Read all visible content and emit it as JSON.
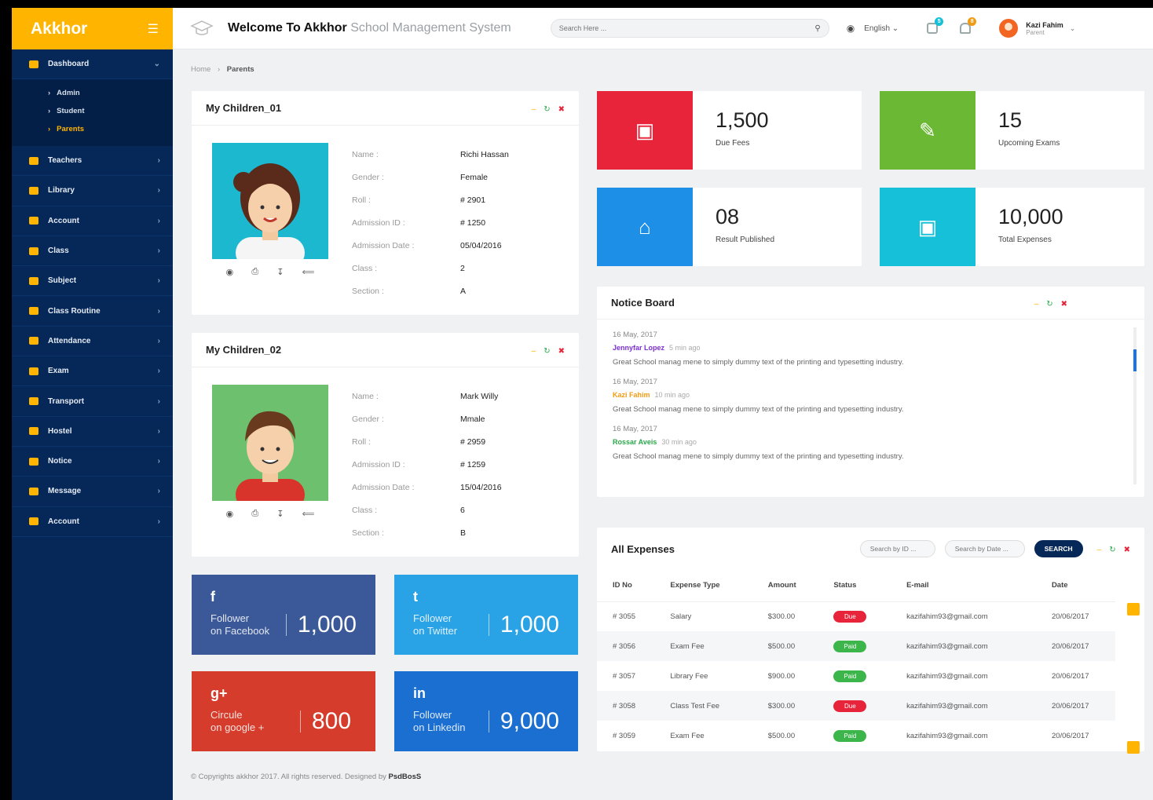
{
  "brand": {
    "name": "Akkhor"
  },
  "sidebar": {
    "dashboard": "Dashboard",
    "submenu": [
      "Admin",
      "Student",
      "Parents"
    ],
    "items": [
      "Teachers",
      "Library",
      "Account",
      "Class",
      "Subject",
      "Class Routine",
      "Attendance",
      "Exam",
      "Transport",
      "Hostel",
      "Notice",
      "Message",
      "Account"
    ]
  },
  "header": {
    "welcome_bold": "Welcome To Akkhor",
    "welcome_light": "School Management System",
    "search_placeholder": "Search Here ...",
    "language": "English",
    "badge_messages": "5",
    "badge_notifications": "8",
    "user_name": "Kazi Fahim",
    "user_role": "Parent"
  },
  "breadcrumb": {
    "home": "Home",
    "current": "Parents"
  },
  "children": [
    {
      "title": "My Children_01",
      "labels": [
        "Name :",
        "Gender :",
        "Roll :",
        "Admission ID :",
        "Admission Date :",
        "Class :",
        "Section :"
      ],
      "values": [
        "Richi Hassan",
        "Female",
        "# 2901",
        "# 1250",
        "05/04/2016",
        "2",
        "A"
      ]
    },
    {
      "title": "My Children_02",
      "labels": [
        "Name :",
        "Gender :",
        "Roll :",
        "Admission ID :",
        "Admission Date :",
        "Class :",
        "Section :"
      ],
      "values": [
        "Mark Willy",
        "Mmale",
        "# 2959",
        "# 1259",
        "15/04/2016",
        "6",
        "B"
      ]
    }
  ],
  "stats": [
    {
      "value": "1,500",
      "label": "Due Fees",
      "color": "#e8243a",
      "icon": "money-icon"
    },
    {
      "value": "15",
      "label": "Upcoming Exams",
      "color": "#6ab833",
      "icon": "edit-icon"
    },
    {
      "value": "08",
      "label": "Result Published",
      "color": "#1e8fe6",
      "icon": "graduation-cap-icon"
    },
    {
      "value": "10,000",
      "label": "Total Expenses",
      "color": "#16c0d8",
      "icon": "money-icon"
    }
  ],
  "social": [
    {
      "line1": "Follower",
      "line2": "on Facebook",
      "count": "1,000",
      "icon": "f",
      "color": "#3b5998"
    },
    {
      "line1": "Follower",
      "line2": "on Twitter",
      "count": "1,000",
      "icon": "t",
      "color": "#2aa2e6"
    },
    {
      "line1": "Circule",
      "line2": "on google +",
      "count": "800",
      "icon": "g+",
      "color": "#d63c2b"
    },
    {
      "line1": "Follower",
      "line2": "on Linkedin",
      "count": "9,000",
      "icon": "in",
      "color": "#1b6fd0"
    }
  ],
  "notice_board": {
    "title": "Notice Board",
    "notices": [
      {
        "date": "16 May, 2017",
        "by": "Jennyfar Lopez",
        "ago": "5 min ago",
        "by_color": "#7b2fd1",
        "text": "Great School manag mene to simply dummy text of the printing and typesetting industry."
      },
      {
        "date": "16 May, 2017",
        "by": "Kazi Fahim",
        "ago": "10 min ago",
        "by_color": "#f29b12",
        "text": "Great School manag mene to simply dummy text of the printing and typesetting industry."
      },
      {
        "date": "16 May, 2017",
        "by": "Rossar Aveis",
        "ago": "30 min ago",
        "by_color": "#2aa84a",
        "text": "Great School manag mene to simply dummy text of the printing and typesetting industry."
      }
    ]
  },
  "expenses": {
    "title": "All Expenses",
    "search_id_placeholder": "Search by ID ...",
    "search_date_placeholder": "Search by Date ...",
    "search_button": "SEARCH",
    "columns": [
      "ID No",
      "Expense Type",
      "Amount",
      "Status",
      "E-mail",
      "Date"
    ],
    "rows": [
      {
        "id": "# 3055",
        "type": "Salary",
        "amount": "$300.00",
        "status": "Due",
        "status_color": "#e8243a",
        "email": "kazifahim93@gmail.com",
        "date": "20/06/2017"
      },
      {
        "id": "# 3056",
        "type": "Exam Fee",
        "amount": "$500.00",
        "status": "Paid",
        "status_color": "#3cb54a",
        "email": "kazifahim93@gmail.com",
        "date": "20/06/2017"
      },
      {
        "id": "# 3057",
        "type": "Library Fee",
        "amount": "$900.00",
        "status": "Paid",
        "status_color": "#3cb54a",
        "email": "kazifahim93@gmail.com",
        "date": "20/06/2017"
      },
      {
        "id": "# 3058",
        "type": "Class Test Fee",
        "amount": "$300.00",
        "status": "Due",
        "status_color": "#e8243a",
        "email": "kazifahim93@gmail.com",
        "date": "20/06/2017"
      },
      {
        "id": "# 3059",
        "type": "Exam Fee",
        "amount": "$500.00",
        "status": "Paid",
        "status_color": "#3cb54a",
        "email": "kazifahim93@gmail.com",
        "date": "20/06/2017"
      }
    ]
  },
  "footer": {
    "text": "© Copyrights akkhor 2017. All rights reserved. Designed by",
    "brand": "PsdBosS"
  }
}
